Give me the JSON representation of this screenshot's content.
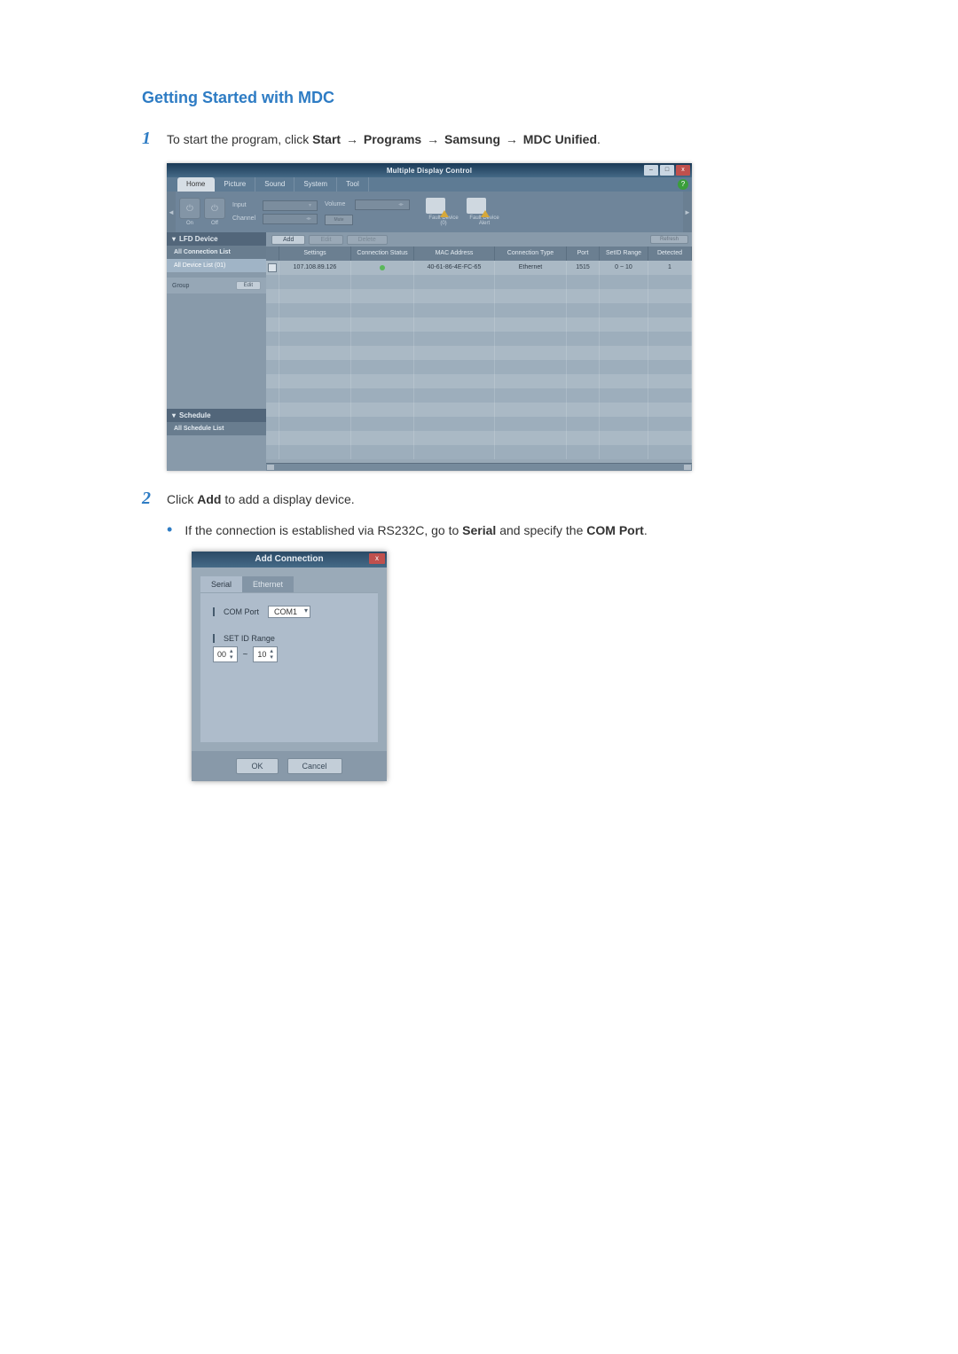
{
  "section_title": "Getting Started with MDC",
  "step1_text_a": "To start the program, click ",
  "step1_path": [
    "Start",
    "Programs",
    "Samsung",
    "MDC Unified"
  ],
  "step2_text": "Click ",
  "step2_bold": "Add",
  "step2_rest": " to add a display device.",
  "step2_bullet_a": "If the connection is established via RS232C, go to ",
  "step2_serial": "Serial",
  "step2_bullet_b": " and specify the ",
  "step2_comport": "COM Port",
  "step2_bullet_c": ".",
  "mdc": {
    "title": "Multiple Display Control",
    "tabs": [
      "Home",
      "Picture",
      "Sound",
      "System",
      "Tool"
    ],
    "input_label": "Input",
    "channel_label": "Channel",
    "volume_label": "Volume",
    "mute_label": "Mute",
    "fault0": "Fault Device (0)",
    "fault1": "Fault Device Alert",
    "side": {
      "lfd": "LFD Device",
      "allconn": "All Connection List",
      "alldev": "All Device List (01)",
      "group": "Group",
      "edit": "Edit",
      "schedule": "Schedule",
      "allsched": "All Schedule List"
    },
    "toolbar": {
      "add": "Add",
      "edit": "Edit",
      "delete": "Delete",
      "refresh": "Refresh"
    },
    "columns": [
      "Settings",
      "Connection Status",
      "MAC Address",
      "Connection Type",
      "Port",
      "SetID Range",
      "Detected Devices"
    ],
    "row": {
      "settings": "107.108.89.126",
      "mac": "40-61-86-4E-FC-65",
      "ctype": "Ethernet",
      "port": "1515",
      "range": "0 ~ 10",
      "detect": "1"
    }
  },
  "dlg": {
    "title": "Add Connection",
    "tab_serial": "Serial",
    "tab_eth": "Ethernet",
    "comport_label": "COM Port",
    "comport_value": "COM1",
    "setid_label": "SET ID Range",
    "range_from": "00",
    "range_to": "10",
    "ok": "OK",
    "cancel": "Cancel"
  }
}
